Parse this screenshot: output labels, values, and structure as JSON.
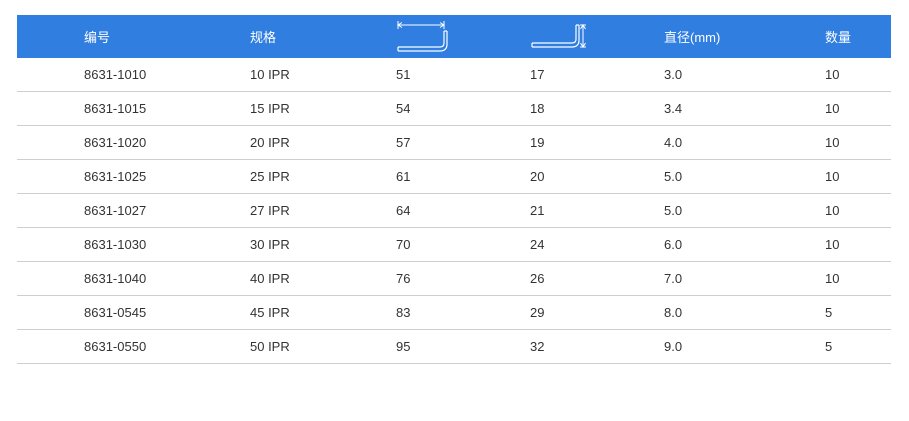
{
  "header": {
    "col_code": "编号",
    "col_spec": "规格",
    "col_length_icon": "long-arm-length-icon",
    "col_short_icon": "short-arm-length-icon",
    "col_diameter": "直径(mm)",
    "col_quantity": "数量"
  },
  "rows": [
    {
      "code": "8631-1010",
      "spec": "10 IPR",
      "long": "51",
      "short": "17",
      "diameter": "3.0",
      "qty": "10"
    },
    {
      "code": "8631-1015",
      "spec": "15 IPR",
      "long": "54",
      "short": "18",
      "diameter": "3.4",
      "qty": "10"
    },
    {
      "code": "8631-1020",
      "spec": "20 IPR",
      "long": "57",
      "short": "19",
      "diameter": "4.0",
      "qty": "10"
    },
    {
      "code": "8631-1025",
      "spec": "25 IPR",
      "long": "61",
      "short": "20",
      "diameter": "5.0",
      "qty": "10"
    },
    {
      "code": "8631-1027",
      "spec": "27 IPR",
      "long": "64",
      "short": "21",
      "diameter": "5.0",
      "qty": "10"
    },
    {
      "code": "8631-1030",
      "spec": "30 IPR",
      "long": "70",
      "short": "24",
      "diameter": "6.0",
      "qty": "10"
    },
    {
      "code": "8631-1040",
      "spec": "40 IPR",
      "long": "76",
      "short": "26",
      "diameter": "7.0",
      "qty": "10"
    },
    {
      "code": "8631-0545",
      "spec": "45 IPR",
      "long": "83",
      "short": "29",
      "diameter": "8.0",
      "qty": "5"
    },
    {
      "code": "8631-0550",
      "spec": "50 IPR",
      "long": "95",
      "short": "32",
      "diameter": "9.0",
      "qty": "5"
    }
  ],
  "colors": {
    "header_bg": "#2f7ee0",
    "header_text": "#ffffff",
    "row_divider": "#cfcfcf",
    "body_text": "#333333"
  }
}
